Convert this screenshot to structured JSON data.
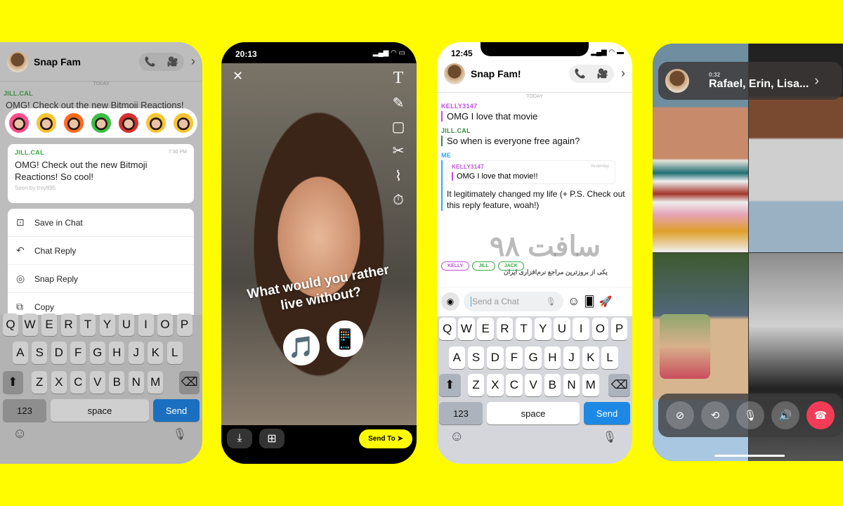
{
  "colors": {
    "brand": "#FFFC00",
    "send": "#1e88e5",
    "jill": "#3aa845",
    "kelly": "#c04de0",
    "me": "#2ea7ff",
    "end_call": "#f23c57"
  },
  "phone1": {
    "title": "Snap Fam",
    "call_icon": "phone-icon",
    "video_icon": "video-icon",
    "date": "TODAY",
    "bg_sender": "JILL.CAL",
    "bg_msg": "OMG! Check out the new Bitmoji Reactions!",
    "reactions": [
      "heart",
      "crying-laugh",
      "fire",
      "thumbs-up",
      "thumbs-down",
      "tears",
      "surprised"
    ],
    "card": {
      "sender": "JILL.CAL",
      "time": "7:30 PM",
      "text": "OMG! Check out the new Bitmoji Reactions! So cool!",
      "seen": "Seen by troy895"
    },
    "menu": [
      {
        "label": "Save in Chat",
        "icon": "save-icon"
      },
      {
        "label": "Chat Reply",
        "icon": "reply-icon"
      },
      {
        "label": "Snap Reply",
        "icon": "camera-icon"
      },
      {
        "label": "Copy",
        "icon": "copy-icon"
      }
    ],
    "keyboard": {
      "row1": [
        "Q",
        "W",
        "E",
        "R",
        "T",
        "Y",
        "U",
        "I",
        "O",
        "P"
      ],
      "row2": [
        "A",
        "S",
        "D",
        "F",
        "G",
        "H",
        "J",
        "K",
        "L"
      ],
      "row3": [
        "Z",
        "X",
        "C",
        "V",
        "B",
        "N",
        "M"
      ],
      "num": "123",
      "space": "space",
      "send": "Send"
    }
  },
  "phone2": {
    "time": "20:13",
    "question": "What would you rather live without?",
    "option_a": "🎵",
    "option_b": "📱",
    "send_to": "Send To",
    "tools": [
      "text-icon",
      "pencil-icon",
      "sticker-icon",
      "scissors-icon",
      "paperclip-icon",
      "timer-icon"
    ]
  },
  "phone3": {
    "time": "12:45",
    "title": "Snap Fam!",
    "date": "TODAY",
    "messages": [
      {
        "sender": "KELLY3147",
        "text": "OMG I love that movie"
      },
      {
        "sender": "JILL.CAL",
        "text": "So when is everyone free again?"
      }
    ],
    "reply": {
      "sender": "ME",
      "quoted_sender": "KELLY3147",
      "quoted_time": "Yesterday",
      "quoted_text": "OMG I love that movie!!",
      "text": "It legitimately changed my life (+ P.S. Check out this reply feature, woah!)"
    },
    "presence": [
      "KELLY",
      "JILL",
      "JACK"
    ],
    "input_placeholder": "Send a Chat",
    "keyboard": {
      "row1": [
        "Q",
        "W",
        "E",
        "R",
        "T",
        "Y",
        "U",
        "I",
        "O",
        "P"
      ],
      "row2": [
        "A",
        "S",
        "D",
        "F",
        "G",
        "H",
        "J",
        "K",
        "L"
      ],
      "row3": [
        "Z",
        "X",
        "C",
        "V",
        "B",
        "N",
        "M"
      ],
      "num": "123",
      "space": "space",
      "send": "Send"
    }
  },
  "watermark": {
    "title": "سافت ۹۸",
    "subtitle": "یکی از بروزترین مراجع نرم‌افزاری ایران"
  },
  "phone4": {
    "duration": "0:32",
    "participants": "Rafael, Erin, Lisa...",
    "controls": [
      "camera-off-icon",
      "flip-camera-icon",
      "mute-icon",
      "speaker-icon",
      "end-call-icon"
    ]
  }
}
